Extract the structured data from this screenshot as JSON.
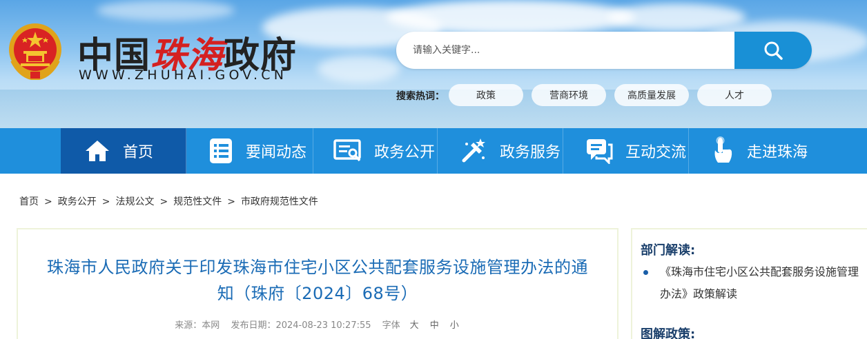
{
  "header": {
    "logo_prefix": "中国",
    "logo_red": "珠海",
    "logo_suffix": "政府",
    "logo_en": "WWW.ZHUHAI.GOV.CN"
  },
  "search": {
    "placeholder": "请输入关键字...",
    "hot_label": "搜索热词：",
    "hot_tags": [
      "政策",
      "营商环境",
      "高质量发展",
      "人才"
    ]
  },
  "nav": {
    "items": [
      {
        "label": "首页",
        "icon": "home-icon"
      },
      {
        "label": "要闻动态",
        "icon": "news-list-icon"
      },
      {
        "label": "政务公开",
        "icon": "open-gov-icon"
      },
      {
        "label": "政务服务",
        "icon": "service-tools-icon"
      },
      {
        "label": "互动交流",
        "icon": "chat-icon"
      },
      {
        "label": "走进珠海",
        "icon": "tap-hand-icon"
      }
    ]
  },
  "breadcrumb": [
    "首页",
    "政务公开",
    "法规公文",
    "规范性文件",
    "市政府规范性文件"
  ],
  "breadcrumb_sep": ">",
  "article": {
    "title_line1": "珠海市人民政府关于印发珠海市住宅小区公共配套服务设施管理办法的通",
    "title_line2": "知（珠府〔2024〕68号）",
    "source_label": "来源：本网",
    "date_label": "发布日期：2024-08-23 10:27:55",
    "font_label": "字体",
    "font_sizes": [
      "大",
      "中",
      "小"
    ]
  },
  "sidebar": {
    "section1_title": "部门解读:",
    "section1_link": "《珠海市住宅小区公共配套服务设施管理办法》政策解读",
    "section2_title": "图解政策:"
  },
  "colors": {
    "nav_bg": "#1f8fdc",
    "nav_active": "#0f5aa8",
    "title_blue": "#1a6bb5",
    "search_btn": "#1990d6",
    "logo_red": "#d42020"
  }
}
